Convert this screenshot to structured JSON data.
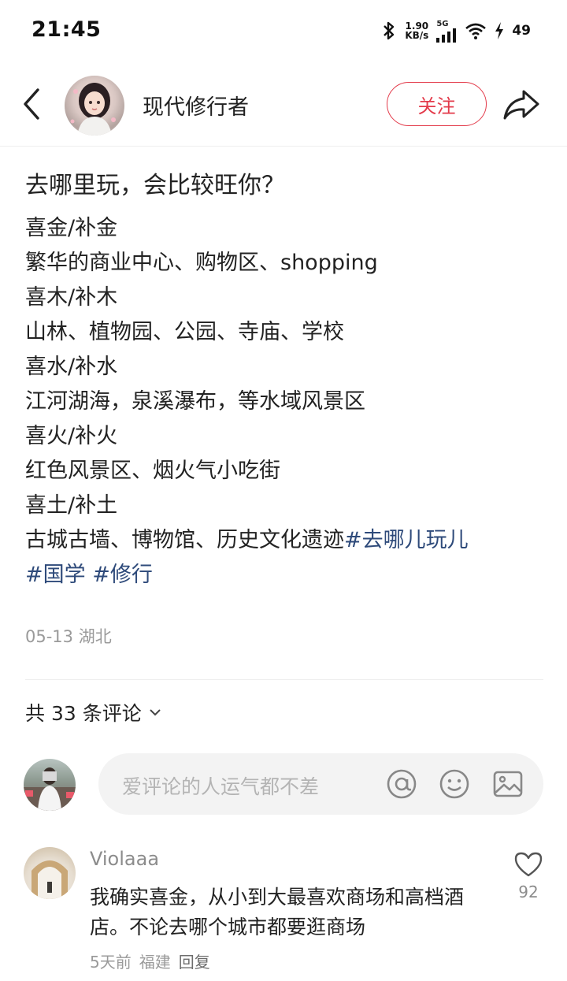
{
  "status_bar": {
    "time": "21:45",
    "speed_value": "1.90",
    "speed_unit": "KB/s",
    "network": "5G",
    "battery": "49"
  },
  "header": {
    "author_name": "现代修行者",
    "follow_label": "关注"
  },
  "post": {
    "title": "去哪里玩，会比较旺你？",
    "lines": [
      "喜金/补金",
      "繁华的商业中心、购物区、shopping",
      "喜木/补木",
      "山林、植物园、公园、寺庙、学校",
      "喜水/补水",
      "江河湖海，泉溪瀑布，等水域风景区",
      "喜火/补火",
      "红色风景区、烟火气小吃街",
      "喜土/补土",
      "古城古墙、博物馆、历史文化遗迹"
    ],
    "tags": [
      "#去哪儿玩儿",
      "#国学",
      "#修行"
    ],
    "date": "05-13",
    "location": "湖北"
  },
  "comments_section": {
    "count_label": "共 33 条评论",
    "input_placeholder": "爱评论的人运气都不差",
    "icons": [
      "at-icon",
      "emoji-icon",
      "image-icon"
    ]
  },
  "comment": {
    "user": "Violaaa",
    "text": "我确实喜金，从小到大最喜欢商场和高档酒店。不论去哪个城市都要逛商场",
    "time": "5天前",
    "location": "福建",
    "reply_label": "回复",
    "likes": "92"
  },
  "colors": {
    "accent": "#e33b4b",
    "tag": "#2e4a7a",
    "meta": "#9a9a9a"
  }
}
